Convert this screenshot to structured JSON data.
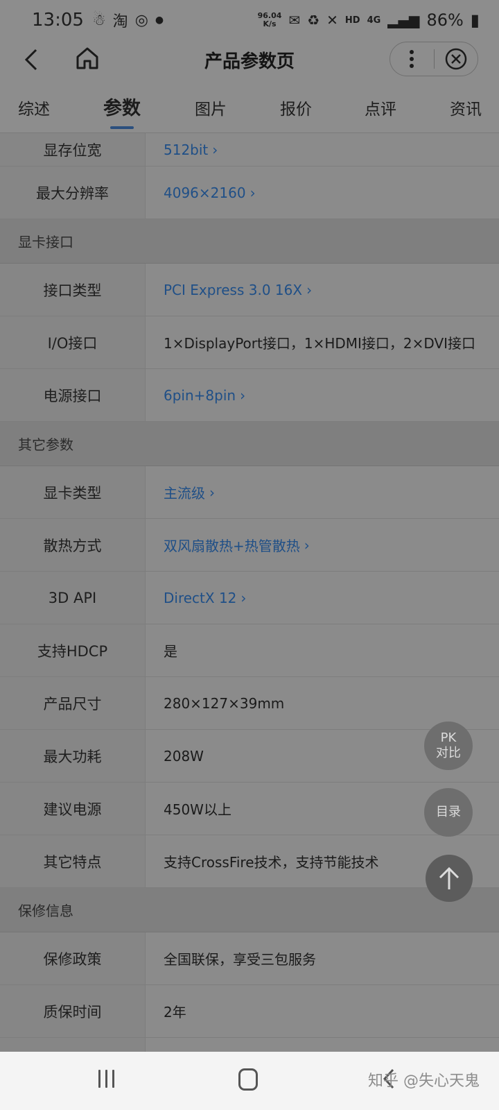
{
  "status_bar": {
    "time": "13:05",
    "net_speed_value": "96.04",
    "net_speed_unit": "K/s",
    "network": "4G",
    "battery": "86%",
    "hd": "HD"
  },
  "header": {
    "title": "产品参数页"
  },
  "tabs": [
    {
      "label": "综述"
    },
    {
      "label": "参数"
    },
    {
      "label": "图片"
    },
    {
      "label": "报价"
    },
    {
      "label": "点评"
    },
    {
      "label": "资讯"
    }
  ],
  "rows": {
    "r1": {
      "label": "显存位宽",
      "value": "512bit"
    },
    "r2": {
      "label": "最大分辨率",
      "value": "4096×2160"
    },
    "s1": {
      "title": "显卡接口"
    },
    "r3": {
      "label": "接口类型",
      "value": "PCI Express 3.0 16X"
    },
    "r4": {
      "label": "I/O接口",
      "value": "1×DisplayPort接口，1×HDMI接口，2×DVI接口"
    },
    "r5": {
      "label": "电源接口",
      "value": "6pin+8pin"
    },
    "s2": {
      "title": "其它参数"
    },
    "r6": {
      "label": "显卡类型",
      "value": "主流级"
    },
    "r7": {
      "label": "散热方式",
      "value": "双风扇散热+热管散热"
    },
    "r8": {
      "label": "3D API",
      "value": "DirectX 12"
    },
    "r9": {
      "label": "支持HDCP",
      "value": "是"
    },
    "r10": {
      "label": "产品尺寸",
      "value": "280×127×39mm"
    },
    "r11": {
      "label": "最大功耗",
      "value": "208W"
    },
    "r12": {
      "label": "建议电源",
      "value": "450W以上"
    },
    "r13": {
      "label": "其它特点",
      "value": "支持CrossFire技术，支持节能技术"
    },
    "s3": {
      "title": "保修信息"
    },
    "r14": {
      "label": "保修政策",
      "value": "全国联保，享受三包服务"
    },
    "r15": {
      "label": "质保时间",
      "value": "2年"
    }
  },
  "floating": {
    "pk_line1": "PK",
    "pk_line2": "对比",
    "toc": "目录"
  },
  "watermark": "知乎 @失心天鬼",
  "colors": {
    "link": "#1f4f87",
    "tab_indicator": "#2b4f7e"
  }
}
